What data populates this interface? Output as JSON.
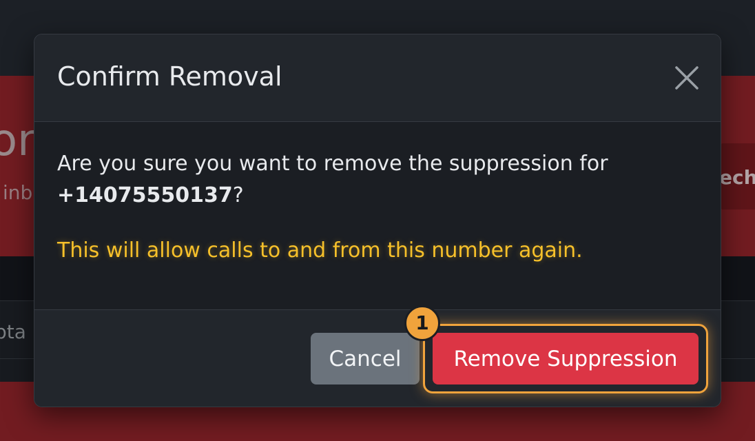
{
  "background": {
    "title_fragment": "on",
    "subtitle_fragment": "inb",
    "action_fragment": "ech",
    "row_fragment": "pta"
  },
  "modal": {
    "title": "Confirm Removal",
    "close_icon": "close-icon",
    "body": {
      "confirm_prefix": "Are you sure you want to remove the suppression for",
      "phone_number": "+14075550137",
      "confirm_suffix": "?",
      "warning": "This will allow calls to and from this number again."
    },
    "footer": {
      "cancel_label": "Cancel",
      "remove_label": "Remove Suppression",
      "step_badge": "1"
    }
  },
  "colors": {
    "danger": "#dc3545",
    "secondary": "#6b737c",
    "warning": "#f6c02a",
    "highlight": "#f0a33c"
  }
}
